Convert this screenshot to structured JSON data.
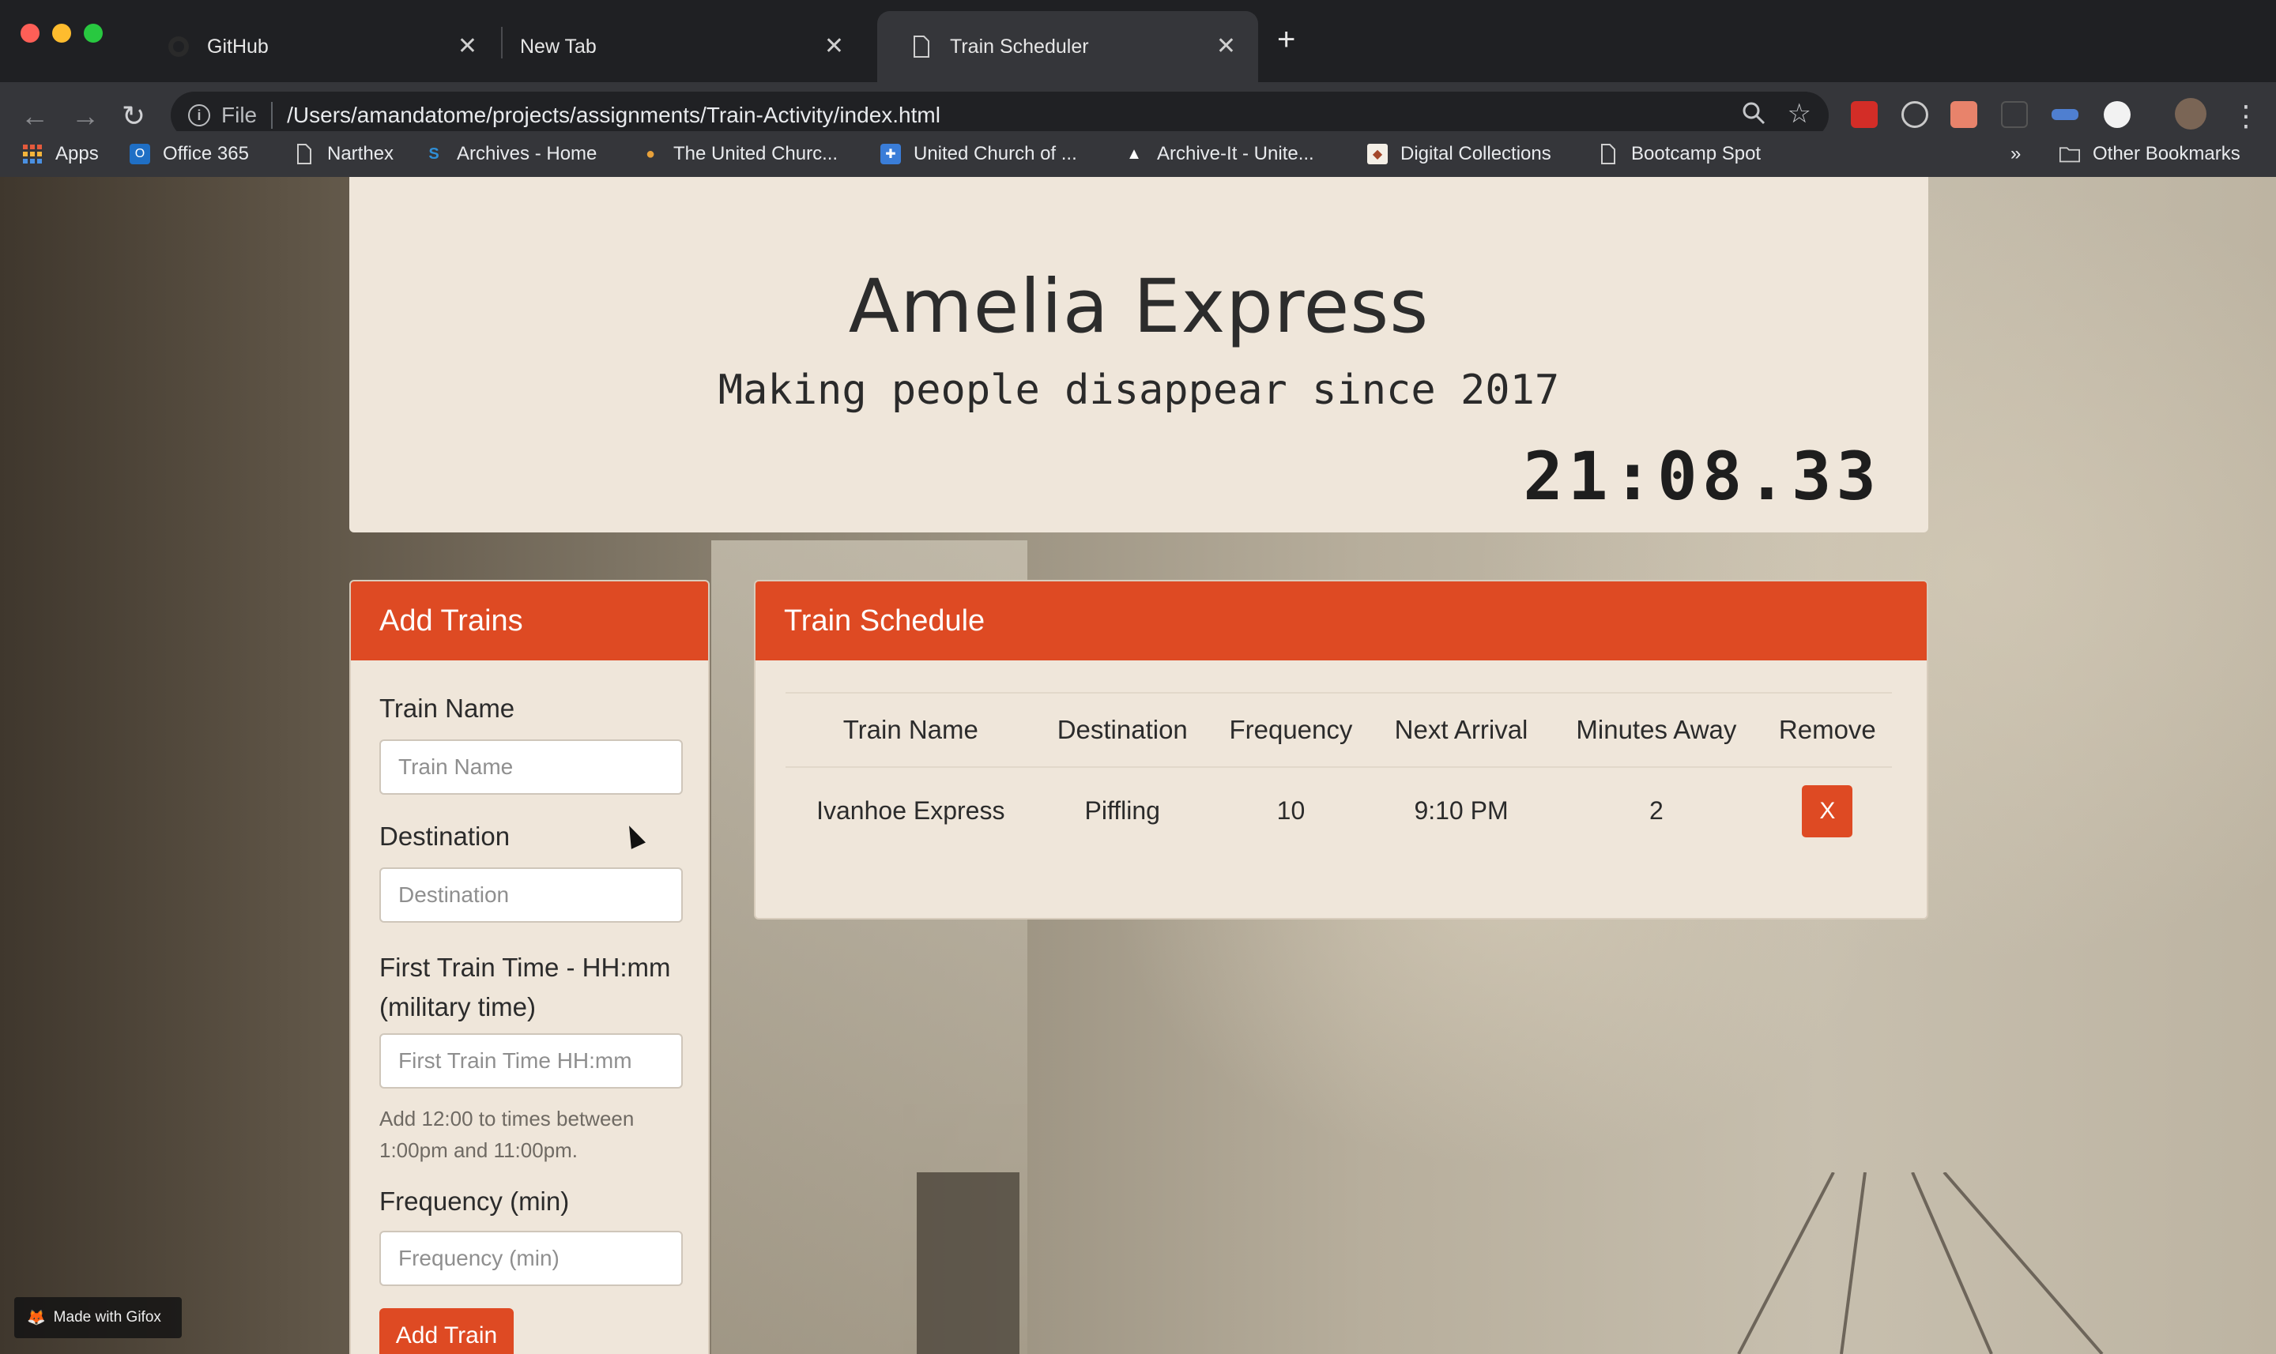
{
  "browser": {
    "tabs": [
      {
        "title": "GitHub",
        "active": false
      },
      {
        "title": "New Tab",
        "active": false
      },
      {
        "title": "Train Scheduler",
        "active": true
      }
    ],
    "address": {
      "scheme_label": "File",
      "url": "/Users/amandatome/projects/assignments/Train-Activity/index.html"
    },
    "bookmarks": [
      "Apps",
      "Office 365",
      "Narthex",
      "Archives - Home",
      "The United Churc...",
      "United Church of ...",
      "Archive-It - Unite...",
      "Digital Collections",
      "Bootcamp Spot"
    ],
    "overflow_label": "»",
    "other_bookmarks": "Other Bookmarks",
    "accent_color": "#de4a23"
  },
  "header": {
    "title": "Amelia Express",
    "subtitle": "Making people disappear since 2017",
    "clock": "21:08.33"
  },
  "add_panel": {
    "title": "Add Trains",
    "fields": [
      {
        "label": "Train Name",
        "placeholder": "Train Name"
      },
      {
        "label": "Destination",
        "placeholder": "Destination"
      },
      {
        "label": "First Train Time - HH:mm (military time)",
        "placeholder": "First Train Time HH:mm"
      },
      {
        "label": "Frequency (min)",
        "placeholder": "Frequency (min)"
      }
    ],
    "help": "Add 12:00 to times between 1:00pm and 11:00pm.",
    "submit": "Add Train"
  },
  "schedule": {
    "title": "Train Schedule",
    "columns": [
      "Train Name",
      "Destination",
      "Frequency",
      "Next Arrival",
      "Minutes Away",
      "Remove"
    ],
    "rows": [
      {
        "name": "Ivanhoe Express",
        "destination": "Piffling",
        "frequency": "10",
        "next_arrival": "9:10 PM",
        "minutes_away": "2",
        "remove_label": "X"
      }
    ]
  },
  "watermark": "Made with Gifox"
}
